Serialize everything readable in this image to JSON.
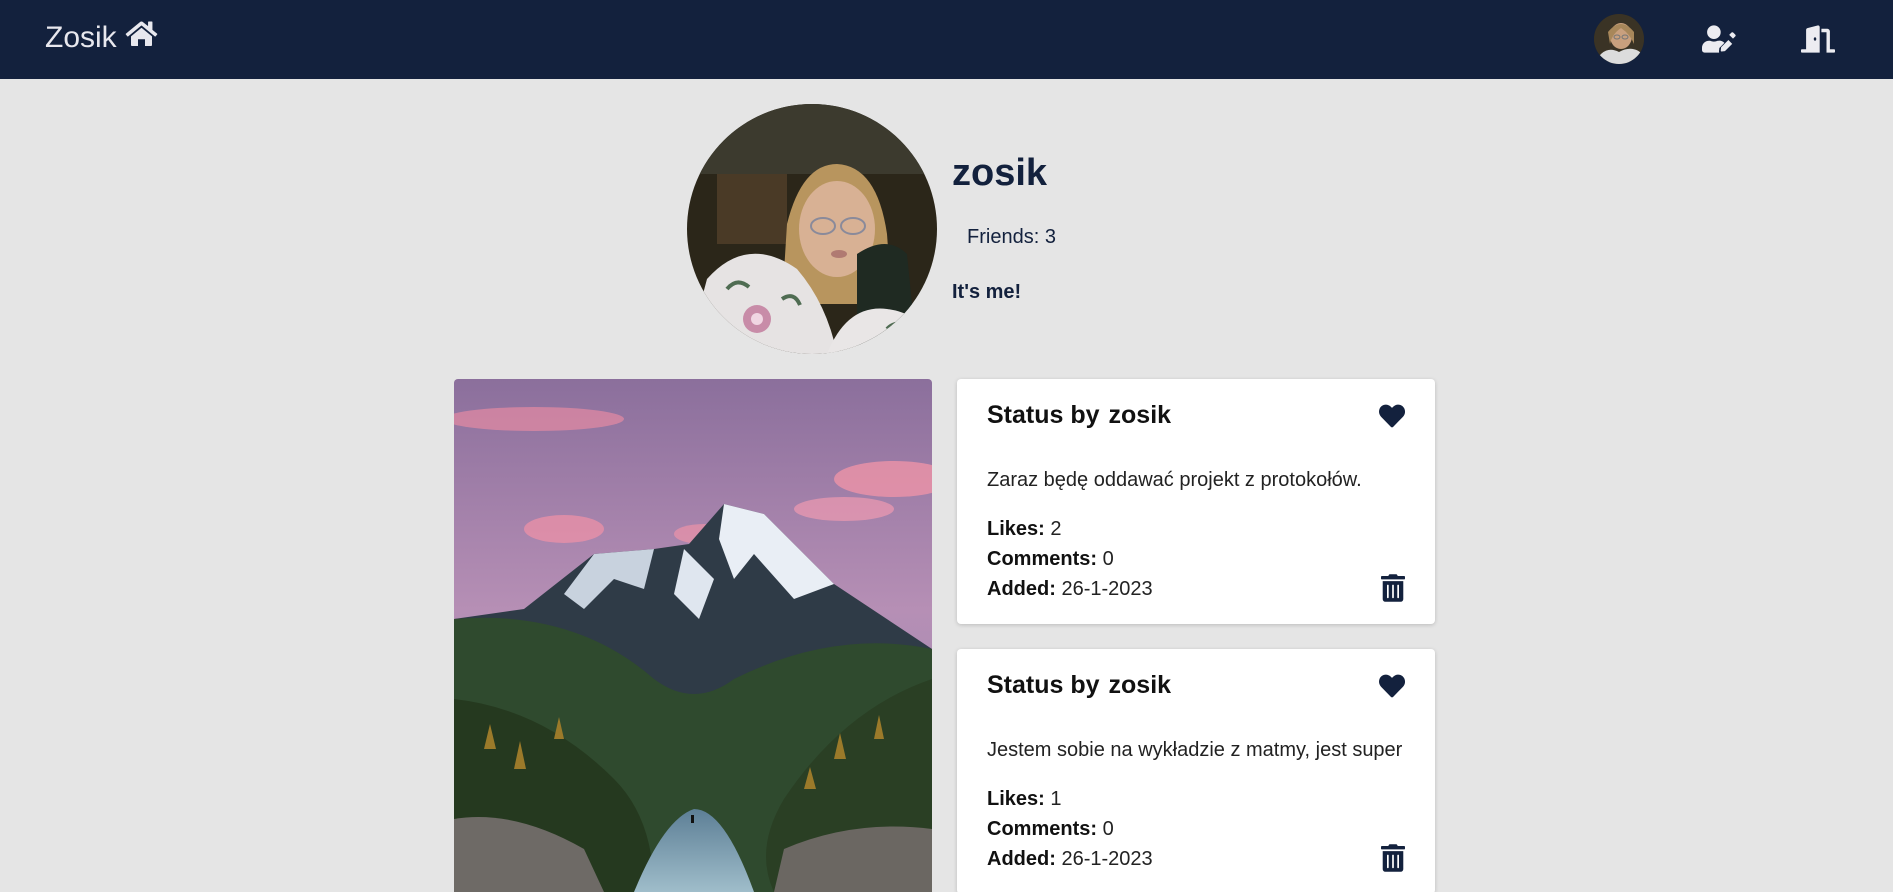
{
  "nav": {
    "brand": "Zosik",
    "brand_icon": "home-icon",
    "icons": [
      "avatar",
      "user-edit-icon",
      "logout-door-icon"
    ]
  },
  "profile": {
    "username": "zosik",
    "friends_label": "Friends:",
    "friends_count": "3",
    "bio": "It's me!"
  },
  "posts": [
    {
      "title_prefix": "Status by",
      "author": "zosik",
      "text": "Zaraz będę oddawać projekt z protokołów.",
      "likes_label": "Likes:",
      "likes": "2",
      "comments_label": "Comments:",
      "comments": "0",
      "added_label": "Added:",
      "added": "26-1-2023"
    },
    {
      "title_prefix": "Status by",
      "author": "zosik",
      "text": "Jestem sobie na wykładzie z matmy, jest super",
      "likes_label": "Likes:",
      "likes": "1",
      "comments_label": "Comments:",
      "comments": "0",
      "added_label": "Added:",
      "added": "26-1-2023"
    }
  ],
  "colors": {
    "navbar": "#13213d",
    "background": "#e5e5e5",
    "accent": "#13213d",
    "card": "#ffffff"
  }
}
